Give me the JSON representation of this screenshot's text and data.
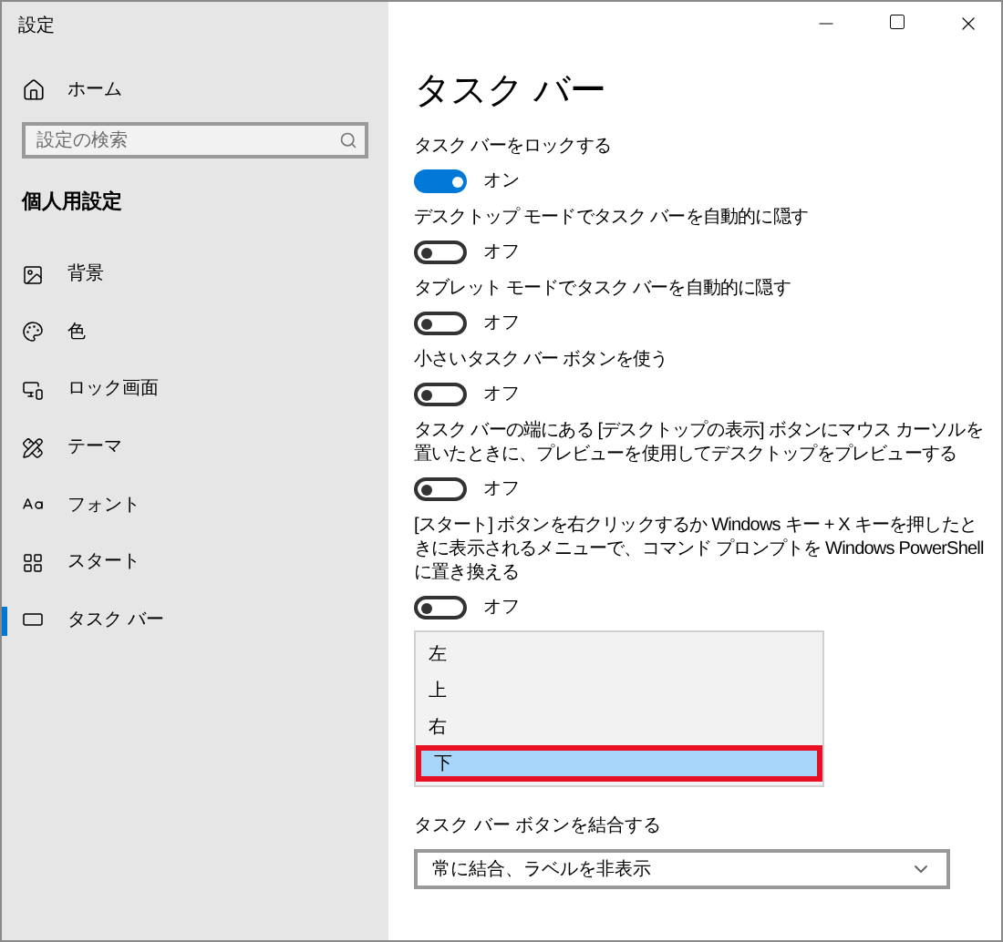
{
  "window": {
    "title": "設定"
  },
  "sidebar": {
    "home": "ホーム",
    "search": {
      "placeholder": "設定の検索"
    },
    "section": "個人用設定",
    "items": [
      {
        "label": "背景",
        "kind": "image",
        "selected": false
      },
      {
        "label": "色",
        "kind": "palette",
        "selected": false
      },
      {
        "label": "ロック画面",
        "kind": "lock-screen",
        "selected": false
      },
      {
        "label": "テーマ",
        "kind": "theme",
        "selected": false
      },
      {
        "label": "フォント",
        "kind": "font",
        "selected": false
      },
      {
        "label": "スタート",
        "kind": "start",
        "selected": false
      },
      {
        "label": "タスク バー",
        "kind": "taskbar",
        "selected": true
      }
    ]
  },
  "page": {
    "title": "タスク バー",
    "settings": [
      {
        "label": "タスク バーをロックする",
        "on": true,
        "state": "オン"
      },
      {
        "label": "デスクトップ モードでタスク バーを自動的に隠す",
        "on": false,
        "state": "オフ"
      },
      {
        "label": "タブレット モードでタスク バーを自動的に隠す",
        "on": false,
        "state": "オフ"
      },
      {
        "label": "小さいタスク バー ボタンを使う",
        "on": false,
        "state": "オフ"
      },
      {
        "label": "タスク バーの端にある [デスクトップの表示] ボタンにマウス カーソルを置いたときに、プレビューを使用してデスクトップをプレビューする",
        "on": false,
        "state": "オフ"
      },
      {
        "label": "[スタート] ボタンを右クリックするか Windows キー + X キーを押したときに表示されるメニューで、コマンド プロンプトを Windows PowerShell に置き換える",
        "on": false,
        "state": "オフ"
      }
    ],
    "position_options": [
      {
        "label": "左",
        "selected": false
      },
      {
        "label": "上",
        "selected": false
      },
      {
        "label": "右",
        "selected": false
      },
      {
        "label": "下",
        "selected": true
      }
    ],
    "combine": {
      "label": "タスク バー ボタンを結合する",
      "value": "常に結合、ラベルを非表示"
    }
  }
}
